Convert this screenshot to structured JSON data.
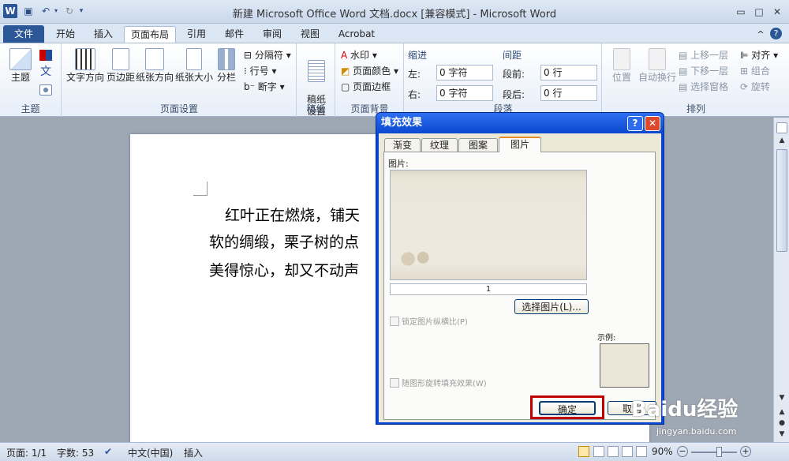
{
  "titlebar": {
    "title": "新建 Microsoft Office Word 文档.docx [兼容模式]  -  Microsoft Word",
    "app_icon": "W",
    "min_glyph": "▭",
    "max_glyph": "□",
    "close_glyph": "✕"
  },
  "tabs": {
    "file": "文件",
    "items": [
      "开始",
      "插入",
      "页面布局",
      "引用",
      "邮件",
      "审阅",
      "视图",
      "Acrobat"
    ],
    "help_glyph": "?",
    "collapse_glyph": "^"
  },
  "ribbon": {
    "theme_group": {
      "label": "主题",
      "themes": "主题",
      "fonts_glyph": "文"
    },
    "page_setup": {
      "label": "页面设置",
      "text_direction": "文字方向",
      "margins": "页边距",
      "orientation": "纸张方向",
      "size": "纸张大小",
      "columns": "分栏",
      "breaks": "分隔符",
      "line_numbers": "行号",
      "hyphenation": "断字"
    },
    "draft": {
      "label": "稿纸",
      "button": "稿纸\n设置"
    },
    "page_background": {
      "label": "页面背景",
      "watermark": "水印",
      "page_color": "页面颜色",
      "page_borders": "页面边框"
    },
    "paragraph": {
      "label": "段落",
      "indent_title": "缩进",
      "spacing_title": "间距",
      "left_label": "左:",
      "left_value": "0 字符",
      "right_label": "右:",
      "right_value": "0 字符",
      "before_label": "段前:",
      "before_value": "0 行",
      "after_label": "段后:",
      "after_value": "0 行"
    },
    "arrange": {
      "label": "排列",
      "position": "位置",
      "wrap": "自动换行",
      "bring_forward": "上移一层",
      "send_backward": "下移一层",
      "selection_pane": "选择窗格",
      "align": "对齐",
      "group": "组合",
      "rotate": "旋转"
    }
  },
  "document": {
    "lines": [
      "红叶正在燃烧，铺天",
      "软的绸缎，栗子树的点",
      "美得惊心，却又不动声"
    ]
  },
  "status": {
    "page": "页面: 1/1",
    "words": "字数: 53",
    "language": "中文(中国)",
    "mode": "插入",
    "zoom": "90%",
    "zoom_minus": "−",
    "zoom_plus": "+"
  },
  "dialog": {
    "title": "填充效果",
    "help_glyph": "?",
    "close_glyph": "✕",
    "tabs": [
      "渐变",
      "纹理",
      "图案",
      "图片"
    ],
    "active_tab": "图片",
    "picture_label": "图片:",
    "picture_name": "1",
    "select_button": "选择图片(L)...",
    "lock_aspect": "锁定图片纵横比(P)",
    "rotate_with_shape": "随图形旋转填充效果(W)",
    "sample_label": "示例:",
    "ok_button": "确定",
    "cancel_button": "取消"
  },
  "watermark": {
    "brand": "Baidu经验",
    "url": "jingyan.baidu.com"
  },
  "colors": {
    "accent": "#2b5797",
    "dialog_title": "#0a46d8",
    "highlight": "#c00000"
  }
}
